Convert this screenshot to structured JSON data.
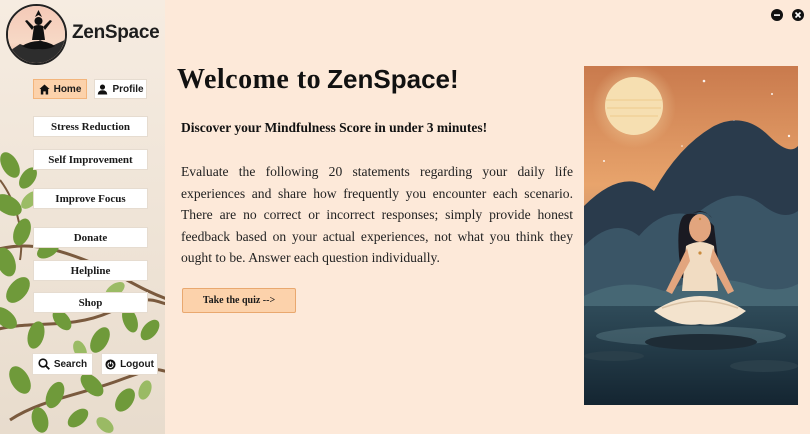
{
  "app": {
    "brand": "ZenSpace"
  },
  "nav": {
    "home": "Home",
    "profile": "Profile",
    "items": [
      "Stress Reduction",
      "Self Improvement",
      "Improve Focus",
      "Donate",
      "Helpline",
      "Shop"
    ],
    "search": "Search",
    "logout": "Logout"
  },
  "main": {
    "welcome_prefix": "Welcome to",
    "welcome_brand": "ZenSpace!",
    "subtitle": "Discover your Mindfulness Score in under 3 minutes!",
    "description": "Evaluate the following 20 statements regarding your daily life experiences and share how frequently you encounter each scen­ario. There are no correct or incorrect responses; simply provide honest feedback based on your actual experiences, not what you think they ought to be. Answer each question individually.",
    "quiz_button": "Take the quiz -->"
  },
  "icons": {
    "logo": "meditation-silhouette-icon",
    "home": "home-icon",
    "profile": "user-icon",
    "search": "search-icon",
    "logout": "power-icon",
    "minimize": "minimize-icon",
    "close": "close-icon"
  },
  "colors": {
    "background": "#fde9d9",
    "accent": "#fcd2ab",
    "text": "#111111",
    "sidebar": "#f1e5d8"
  }
}
